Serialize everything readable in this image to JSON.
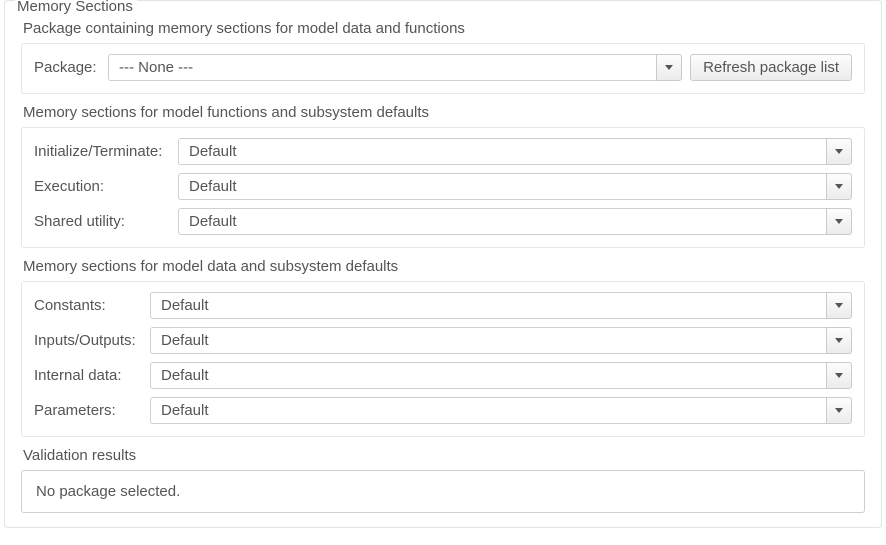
{
  "panel": {
    "title": "Memory Sections"
  },
  "section_package": {
    "title": "Package containing memory sections for model data and functions",
    "label": "Package:",
    "value": "--- None ---",
    "refresh_btn": "Refresh package list"
  },
  "section_functions": {
    "title": "Memory sections for model functions and subsystem defaults",
    "rows": [
      {
        "label": "Initialize/Terminate:",
        "value": "Default"
      },
      {
        "label": "Execution:",
        "value": "Default"
      },
      {
        "label": "Shared utility:",
        "value": "Default"
      }
    ]
  },
  "section_data": {
    "title": "Memory sections for model data and subsystem defaults",
    "rows": [
      {
        "label": "Constants:",
        "value": "Default"
      },
      {
        "label": "Inputs/Outputs:",
        "value": "Default"
      },
      {
        "label": "Internal data:",
        "value": "Default"
      },
      {
        "label": "Parameters:",
        "value": "Default"
      }
    ]
  },
  "section_validation": {
    "title": "Validation results",
    "message": "No package selected."
  }
}
